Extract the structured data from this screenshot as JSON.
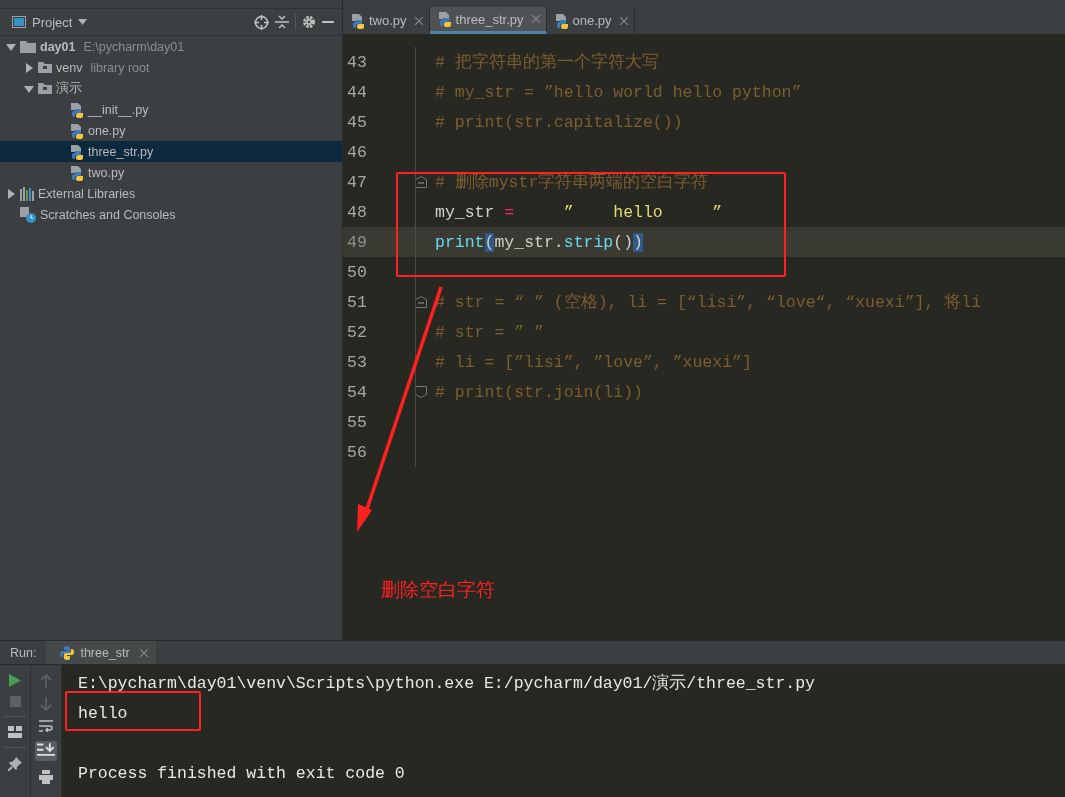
{
  "project_header": {
    "title": "Project"
  },
  "tree": [
    {
      "label": "day01",
      "hint": "E:\\pycharm\\day01",
      "kind": "folder",
      "expanded": true,
      "selected": false,
      "children": [
        {
          "label": "venv",
          "hint": "library root",
          "kind": "module",
          "expanded": false,
          "selected": false
        },
        {
          "label": "演示",
          "kind": "module",
          "expanded": true,
          "selected": false,
          "children": [
            {
              "label": "__init__.py",
              "kind": "python",
              "selected": false
            },
            {
              "label": "one.py",
              "kind": "python",
              "selected": false
            },
            {
              "label": "three_str.py",
              "kind": "python",
              "selected": true
            },
            {
              "label": "two.py",
              "kind": "python",
              "selected": false
            }
          ]
        }
      ]
    },
    {
      "label": "External Libraries",
      "kind": "libraries",
      "expanded": false,
      "selected": false
    },
    {
      "label": "Scratches and Consoles",
      "kind": "scratches",
      "selected": false
    }
  ],
  "tabs": [
    {
      "label": "two.py",
      "selected": false
    },
    {
      "label": "three_str.py",
      "selected": true
    },
    {
      "label": "one.py",
      "selected": false
    }
  ],
  "code_lines": [
    {
      "number": "43",
      "current": false,
      "segments": [
        {
          "text": "# 把字符串的第一个字符大写",
          "kind": "comment"
        }
      ]
    },
    {
      "number": "44",
      "current": false,
      "segments": [
        {
          "text": "# my_str = ”hello world hello python”",
          "kind": "comment"
        }
      ]
    },
    {
      "number": "45",
      "current": false,
      "segments": [
        {
          "text": "# print(str.capitalize())",
          "kind": "comment"
        }
      ]
    },
    {
      "number": "46",
      "current": false
    },
    {
      "number": "47",
      "current": false,
      "fold_start": true,
      "segments": [
        {
          "text": "# 删除mystr字符串两端的空白字符",
          "kind": "comment"
        }
      ]
    },
    {
      "number": "48",
      "current": false,
      "segments": [
        {
          "text": "my_str",
          "kind": "plain"
        },
        {
          "text": " = ",
          "kind": "operator"
        },
        {
          "text": "    ”    hello     ”",
          "kind": "string"
        }
      ]
    },
    {
      "number": "49",
      "current": true,
      "segments": [
        {
          "text": "print",
          "kind": "builtin"
        },
        {
          "text": "(",
          "kind": "match"
        },
        {
          "text": "my_str.",
          "kind": "plain"
        },
        {
          "text": "strip",
          "kind": "builtin"
        },
        {
          "text": "()",
          "kind": "plain"
        },
        {
          "text": ")",
          "kind": "match"
        }
      ]
    },
    {
      "number": "50",
      "current": false
    },
    {
      "number": "51",
      "current": false,
      "fold_start": true,
      "segments": [
        {
          "text": "# str = “ ” (空格), li = [“lisi”, “love“, “xuexi”], 将li",
          "kind": "comment"
        }
      ]
    },
    {
      "number": "52",
      "current": false,
      "segments": [
        {
          "text": "# str = ” ”",
          "kind": "comment"
        }
      ]
    },
    {
      "number": "53",
      "current": false,
      "segments": [
        {
          "text": "# li = [”lisi”, ”love”, ”xuexi”]",
          "kind": "comment"
        }
      ]
    },
    {
      "number": "54",
      "current": false,
      "fold_end": true,
      "segments": [
        {
          "text": "# print(str.join(li))",
          "kind": "comment"
        }
      ]
    },
    {
      "number": "55",
      "current": false
    },
    {
      "number": "56",
      "current": false
    }
  ],
  "annotation": {
    "label": "删除空白字符"
  },
  "run": {
    "label": "Run:",
    "tab": "three_str",
    "output": [
      {
        "text": "E:\\pycharm\\day01\\venv\\Scripts\\python.exe E:/pycharm/day01/演示/three_str.py",
        "kind": "command"
      },
      {
        "text": "hello",
        "kind": "result"
      },
      {
        "text": "Process finished with exit code 0",
        "kind": "status"
      }
    ]
  }
}
